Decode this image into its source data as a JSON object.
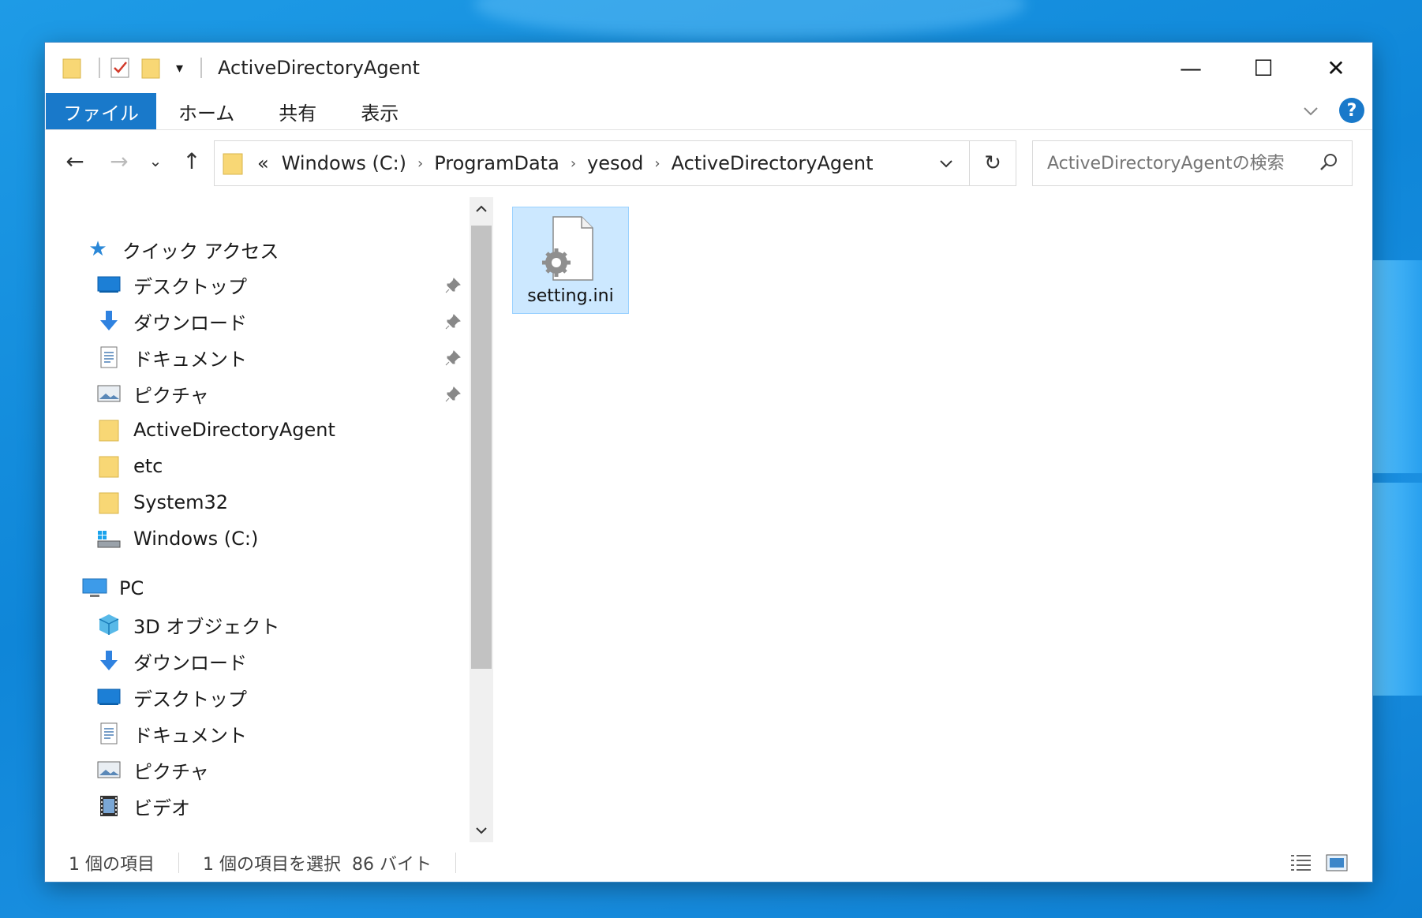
{
  "window": {
    "title": "ActiveDirectoryAgent",
    "controls": {
      "minimize": "—",
      "maximize": "☐",
      "close": "✕"
    }
  },
  "ribbon": {
    "tabs": [
      "ファイル",
      "ホーム",
      "共有",
      "表示"
    ],
    "help_label": "?"
  },
  "nav": {
    "back": "←",
    "forward": "→",
    "recent": "⌄",
    "up": "↑",
    "breadcrumb": [
      "«",
      "Windows (C:)",
      "ProgramData",
      "yesod",
      "ActiveDirectoryAgent"
    ],
    "breadcrumb_sep": "›",
    "refresh": "↻",
    "search_placeholder": "ActiveDirectoryAgentの検索"
  },
  "sidebar": {
    "quick_access": {
      "label": "クイック アクセス",
      "items": [
        {
          "label": "デスクトップ",
          "icon": "desktop-icon",
          "pinned": true
        },
        {
          "label": "ダウンロード",
          "icon": "download-icon",
          "pinned": true
        },
        {
          "label": "ドキュメント",
          "icon": "document-icon",
          "pinned": true
        },
        {
          "label": "ピクチャ",
          "icon": "picture-icon",
          "pinned": true
        },
        {
          "label": "ActiveDirectoryAgent",
          "icon": "folder-icon",
          "pinned": false
        },
        {
          "label": "etc",
          "icon": "folder-icon",
          "pinned": false
        },
        {
          "label": "System32",
          "icon": "folder-icon",
          "pinned": false
        },
        {
          "label": "Windows (C:)",
          "icon": "drive-icon",
          "pinned": false
        }
      ]
    },
    "pc": {
      "label": "PC",
      "items": [
        {
          "label": "3D オブジェクト",
          "icon": "3d-objects-icon"
        },
        {
          "label": "ダウンロード",
          "icon": "download-icon"
        },
        {
          "label": "デスクトップ",
          "icon": "desktop-icon"
        },
        {
          "label": "ドキュメント",
          "icon": "document-icon"
        },
        {
          "label": "ピクチャ",
          "icon": "picture-icon"
        },
        {
          "label": "ビデオ",
          "icon": "video-icon"
        }
      ]
    }
  },
  "content": {
    "files": [
      {
        "name": "setting.ini",
        "icon": "ini-settings-file-icon",
        "selected": true
      }
    ]
  },
  "status": {
    "item_count": "1 個の項目",
    "selection": "1 個の項目を選択  86 バイト"
  },
  "colors": {
    "accent": "#1979CA",
    "selection_bg": "#CCE8FF",
    "selection_border": "#99D1FF",
    "desktop": "#1590DF",
    "folder": "#F8D775"
  }
}
